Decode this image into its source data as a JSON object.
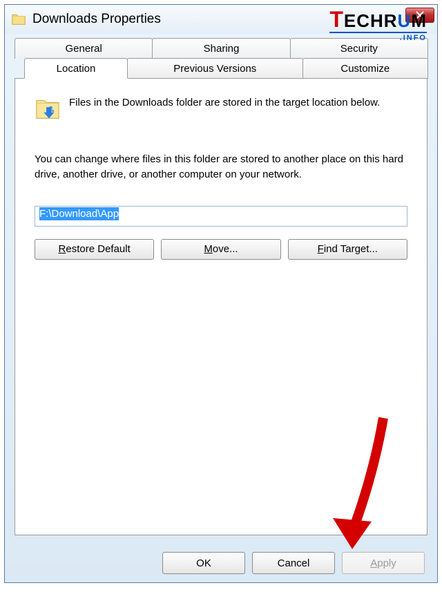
{
  "window": {
    "title": "Downloads Properties"
  },
  "tabs": {
    "row1": [
      "General",
      "Sharing",
      "Security"
    ],
    "row2": {
      "active": "Location",
      "rest": [
        "Previous Versions",
        "Customize"
      ]
    }
  },
  "panel": {
    "intro": "Files in the Downloads folder are stored in the target location below.",
    "hint": "You can change where files in this folder are stored to another place on this hard drive, another drive, or another computer on your network.",
    "path_value": "F:\\Download\\App",
    "buttons": {
      "restore": "Restore Default",
      "move": "Move...",
      "find": "Find Target..."
    }
  },
  "footer": {
    "ok": "OK",
    "cancel": "Cancel",
    "apply": "Apply"
  },
  "logo": {
    "full": "TECHRUM",
    "sub": ".INFO"
  }
}
